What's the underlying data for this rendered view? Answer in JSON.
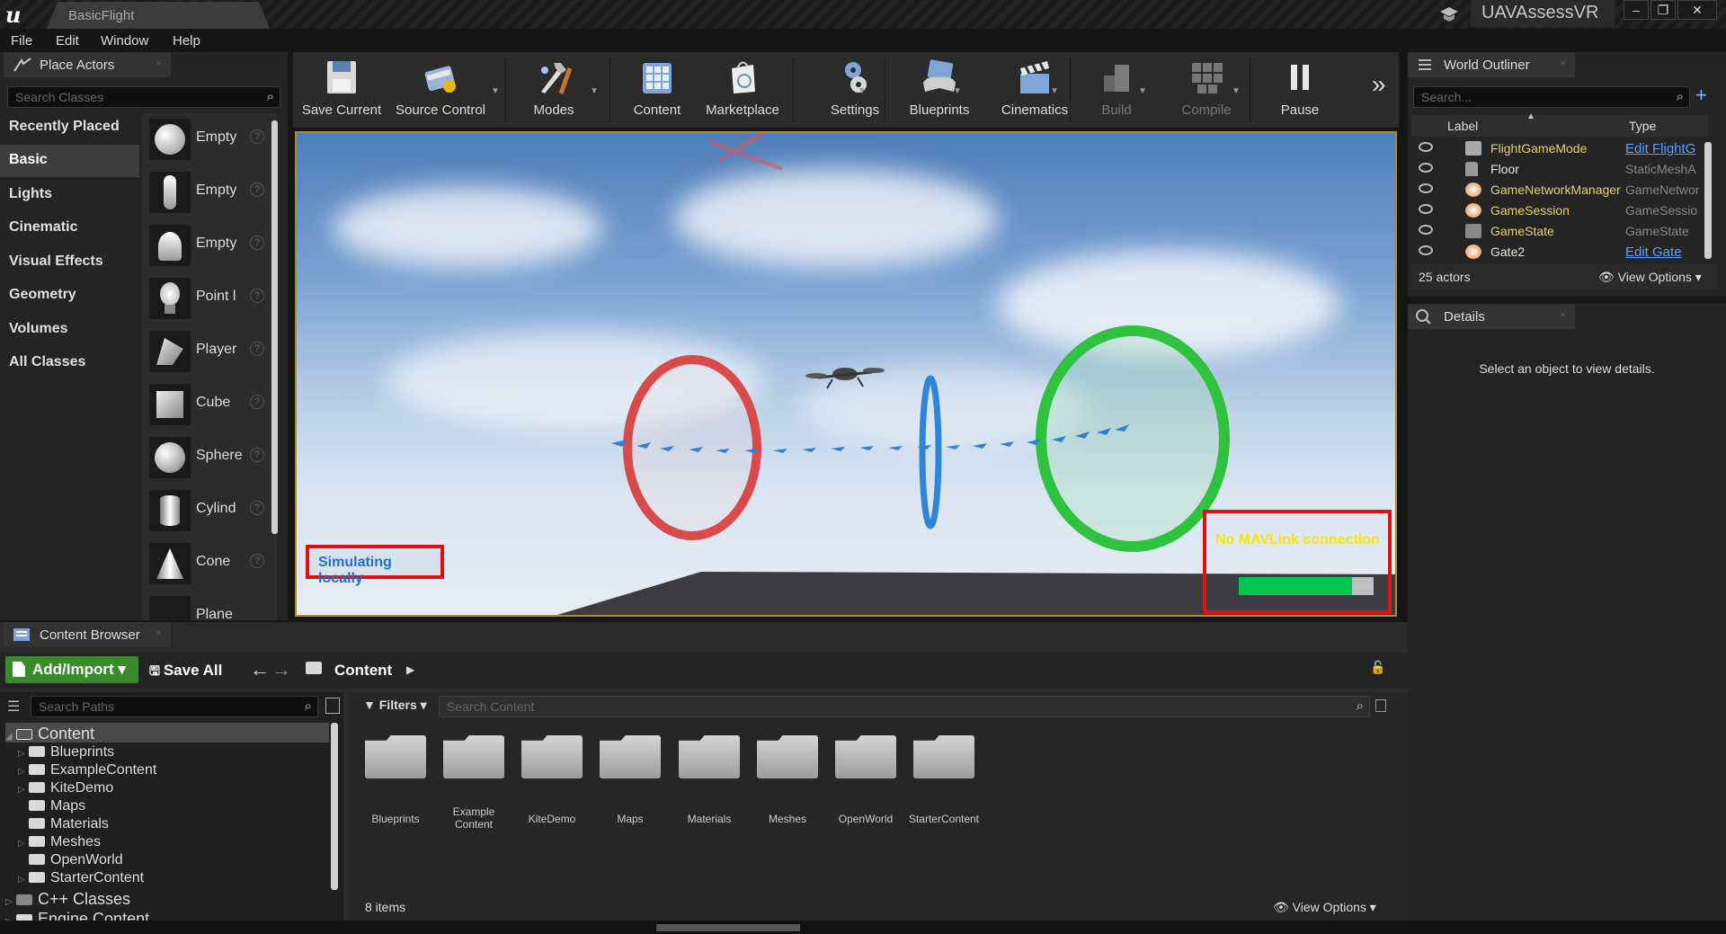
{
  "window": {
    "tab_title": "BasicFlight",
    "project": "UAVAssessVR",
    "minimize": "–",
    "restore": "❐",
    "close": "✕"
  },
  "menu": [
    "File",
    "Edit",
    "Window",
    "Help"
  ],
  "place_actors": {
    "tab": "Place Actors",
    "search_placeholder": "Search Classes",
    "categories": [
      "Recently Placed",
      "Basic",
      "Lights",
      "Cinematic",
      "Visual Effects",
      "Geometry",
      "Volumes",
      "All Classes"
    ],
    "selected_category": "Basic",
    "actors": [
      "Empty",
      "Empty",
      "Empty",
      "Point l",
      "Player",
      "Cube",
      "Sphere",
      "Cylind",
      "Cone",
      "Plane"
    ]
  },
  "toolbar": {
    "buttons": [
      "Save Current",
      "Source Control",
      "Modes",
      "Content",
      "Marketplace",
      "Settings",
      "Blueprints",
      "Cinematics",
      "Build",
      "Compile",
      "Pause"
    ],
    "more": "»"
  },
  "viewport": {
    "status_text": "Simulating locally",
    "mavlink_text": "No MAVLink connection",
    "mavlink_progress": 0.84
  },
  "world_outliner": {
    "tab": "World Outliner",
    "search_placeholder": "Search...",
    "col_label": "Label",
    "col_type": "Type",
    "rows": [
      {
        "label": "FlightGameMode",
        "type": "Edit FlightG",
        "link": true,
        "label_color": "#e8d16a"
      },
      {
        "label": "Floor",
        "type": "StaticMeshA",
        "link": false,
        "label_color": "#e6e6e6"
      },
      {
        "label": "GameNetworkManager",
        "type": "GameNetwor",
        "link": false,
        "label_color": "#e8d16a"
      },
      {
        "label": "GameSession",
        "type": "GameSessio",
        "link": false,
        "label_color": "#e8d16a"
      },
      {
        "label": "GameState",
        "type": "GameState",
        "link": false,
        "label_color": "#e8d16a"
      },
      {
        "label": "Gate2",
        "type": "Edit Gate",
        "link": true,
        "label_color": "#e6e6e6"
      }
    ],
    "actor_count": "25 actors",
    "view_options": "View Options"
  },
  "details": {
    "tab": "Details",
    "empty_text": "Select an object to view details."
  },
  "content_browser": {
    "tab": "Content Browser",
    "add_import": "Add/Import",
    "save_all": "Save All",
    "breadcrumb": "Content",
    "search_paths_placeholder": "Search Paths",
    "filters": "Filters",
    "search_content_placeholder": "Search Content",
    "tree": [
      {
        "label": "Content",
        "level": 0,
        "arrow": "◢"
      },
      {
        "label": "Blueprints",
        "level": 1,
        "arrow": "▷"
      },
      {
        "label": "ExampleContent",
        "level": 1,
        "arrow": "▷"
      },
      {
        "label": "KiteDemo",
        "level": 1,
        "arrow": "▷"
      },
      {
        "label": "Maps",
        "level": 1,
        "arrow": ""
      },
      {
        "label": "Materials",
        "level": 1,
        "arrow": ""
      },
      {
        "label": "Meshes",
        "level": 1,
        "arrow": "▷"
      },
      {
        "label": "OpenWorld",
        "level": 1,
        "arrow": ""
      },
      {
        "label": "StarterContent",
        "level": 1,
        "arrow": "▷"
      },
      {
        "label": "C++ Classes",
        "level": 0,
        "arrow": "▷"
      },
      {
        "label": "Engine Content",
        "level": 0,
        "arrow": "▷"
      }
    ],
    "folders": [
      "Blueprints",
      "Example Content",
      "KiteDemo",
      "Maps",
      "Materials",
      "Meshes",
      "OpenWorld",
      "StarterContent"
    ],
    "item_count": "8 items",
    "view_options": "View Options"
  },
  "colors": {
    "accent_green": "#3b8a2e",
    "alert_red": "#e01010",
    "link_blue": "#5aa0ff",
    "mav_yellow": "#ffe400"
  }
}
